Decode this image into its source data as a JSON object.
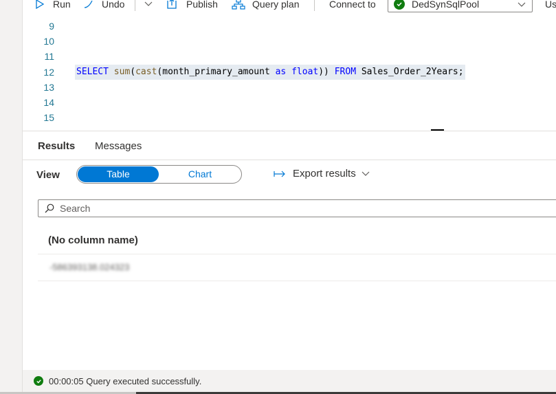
{
  "toolbar": {
    "run_label": "Run",
    "undo_label": "Undo",
    "publish_label": "Publish",
    "query_plan_label": "Query plan",
    "connect_to_label": "Connect to",
    "connection_value": "DedSynSqlPool",
    "use_label": "Us"
  },
  "editor": {
    "line_numbers": [
      "9",
      "10",
      "11",
      "12",
      "13",
      "14",
      "15"
    ],
    "query": {
      "kw_select": "SELECT",
      "fn_sum": "sum",
      "p1": "(",
      "fn_cast": "cast",
      "p2": "(month_primary_amount ",
      "kw_as": "as",
      "sp": " ",
      "kw_float": "float",
      "p3": ")) ",
      "kw_from": "FROM",
      "p4": " Sales_Order_2Years;"
    }
  },
  "results": {
    "tabs": [
      "Results",
      "Messages"
    ],
    "view_label": "View",
    "toggle_table": "Table",
    "toggle_chart": "Chart",
    "export_label": "Export results",
    "search_placeholder": "Search",
    "column_header": "(No column name)",
    "rows": [
      "-586393138.024323"
    ]
  },
  "status": {
    "text": "00:00:05 Query executed successfully."
  },
  "colors": {
    "accent": "#0078d4",
    "success": "#107c10",
    "keyword": "#0000ff",
    "function": "#795e26",
    "line_number": "#237893"
  },
  "icons": {
    "run": "play-icon",
    "undo": "undo-icon",
    "publish": "publish-icon",
    "query_plan": "query-plan-icon",
    "connection_status": "check-circle-icon",
    "search": "search-icon",
    "export": "export-arrow-icon"
  }
}
